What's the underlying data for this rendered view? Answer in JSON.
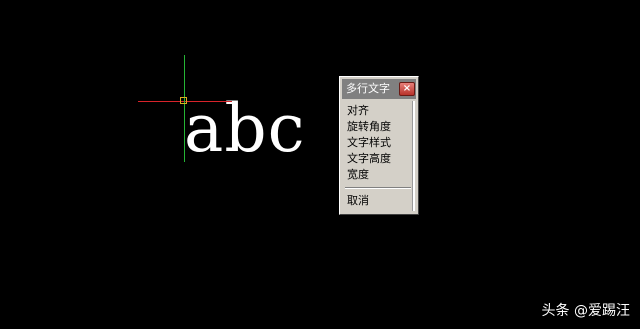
{
  "canvas": {
    "background": "#000000",
    "mtext_preview": "abc",
    "crosshair": {
      "x_axis_color": "#d8232a",
      "y_axis_color": "#25b434",
      "pickbox_color": "#d8b020"
    }
  },
  "context_menu": {
    "title": "多行文字",
    "close_glyph": "×",
    "items": [
      {
        "label": "对齐"
      },
      {
        "label": "旋转角度"
      },
      {
        "label": "文字样式"
      },
      {
        "label": "文字高度"
      },
      {
        "label": "宽度"
      }
    ],
    "cancel_label": "取消"
  },
  "watermark": {
    "text": "头条 @爱踢汪"
  }
}
